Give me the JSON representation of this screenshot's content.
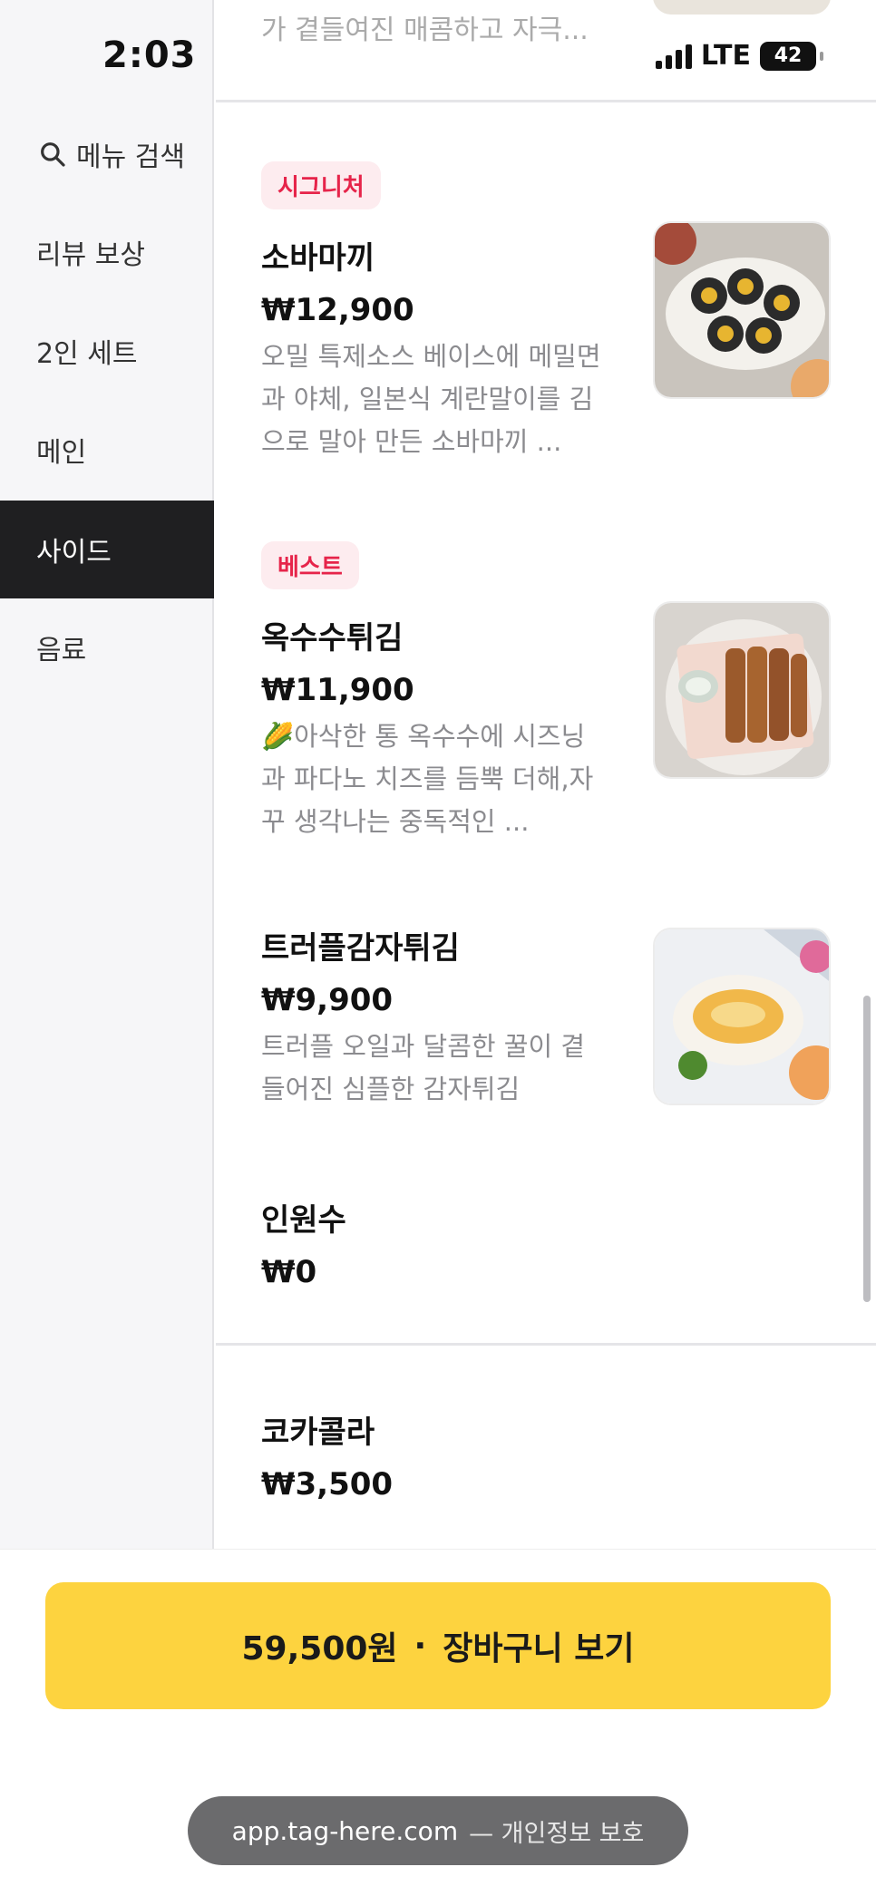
{
  "status": {
    "time": "2:03",
    "network": "LTE",
    "battery": "42"
  },
  "sidebar": {
    "search_label": "메뉴 검색",
    "categories": [
      {
        "label": "리뷰 보상"
      },
      {
        "label": "2인 세트"
      },
      {
        "label": "메인"
      },
      {
        "label": "사이드"
      },
      {
        "label": "음료"
      }
    ],
    "active": "사이드"
  },
  "menu": {
    "previous_desc": "가 곁들여진 매콤하고 자극...",
    "items": [
      {
        "badge": "시그니처",
        "name": "소바마끼",
        "price": "₩12,900",
        "desc": "오밀 특제소스 베이스에 메밀면과 야체, 일본식 계란말이를 김으로 말아 만든 소바마끼 ..."
      },
      {
        "badge": "베스트",
        "name": "옥수수튀김",
        "price": "₩11,900",
        "desc": "🌽아삭한 통 옥수수에 시즈닝과 파다노 치즈를 듬뿍 더해,자꾸 생각나는 중독적인 ..."
      },
      {
        "name": "트러플감자튀김",
        "price": "₩9,900",
        "desc": "트러플 오일과 달콤한 꿀이 곁들어진 심플한 감자튀김"
      },
      {
        "name": "인원수",
        "price": "₩0"
      },
      {
        "name": "코카콜라",
        "price": "₩3,500"
      }
    ]
  },
  "cart": {
    "total": "59,500원",
    "separator": "·",
    "label": "장바구니 보기"
  },
  "browser": {
    "url": "app.tag-here.com",
    "note": "— 개인정보 보호"
  },
  "colors": {
    "accent": "#fdd33f",
    "badge_text": "#e6244a",
    "badge_bg": "#fdecef",
    "sidebar_active": "#1f1f21"
  }
}
